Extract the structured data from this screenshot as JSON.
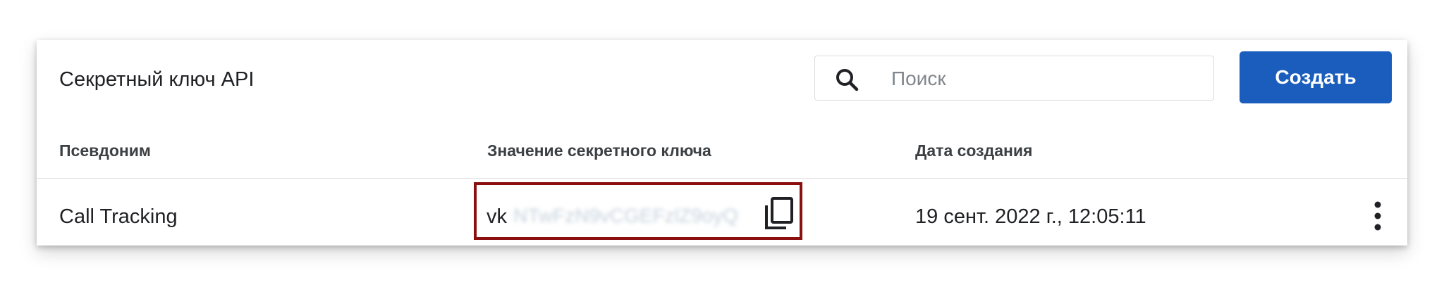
{
  "header": {
    "title": "Секретный ключ API",
    "search_placeholder": "Поиск",
    "create_label": "Создать"
  },
  "table": {
    "columns": [
      "Псевдоним",
      "Значение секретного ключа",
      "Дата создания"
    ],
    "rows": [
      {
        "alias": "Call Tracking",
        "key_prefix": "vk",
        "key_rest": "NTwFzN9vCGEFzlZ9oyQ",
        "created": "19 сент. 2022 г., 12:05:11"
      }
    ]
  },
  "colors": {
    "accent": "#1a5dbd",
    "highlight_border": "#8b0f0f"
  },
  "icons": {
    "search": "search-icon",
    "copy": "copy-icon",
    "more": "more-vert-icon"
  }
}
